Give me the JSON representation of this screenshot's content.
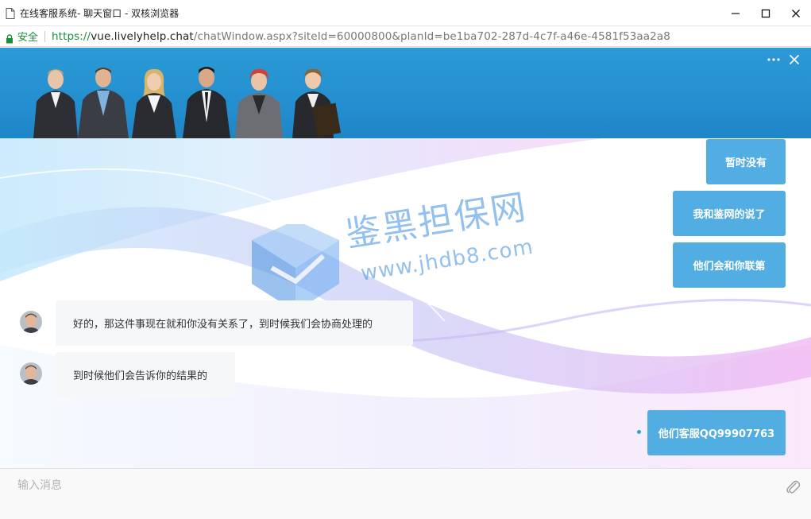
{
  "window": {
    "title": "在线客服系统- 聊天窗口 - 双核浏览器",
    "icons": [
      "document-icon",
      "minimize-icon",
      "maximize-icon",
      "close-icon"
    ]
  },
  "addressbar": {
    "secure_label": "安全",
    "url_scheme": "https://",
    "url_host": "vue.livelyhelp.chat",
    "url_path": "/chatWindow.aspx?siteId=60000800&planId=be1ba702-287d-4c7f-a46e-4581f53aa2a8"
  },
  "chat_header": {
    "icons": [
      "more-icon",
      "close-icon"
    ]
  },
  "watermark": {
    "cn": "鉴黑担保网",
    "en": "www.jhdb8.com"
  },
  "messages": [
    {
      "direction": "out",
      "text": "暂时没有"
    },
    {
      "direction": "out",
      "text": "我和鉴网的说了"
    },
    {
      "direction": "out",
      "text": "他们会和你联第"
    },
    {
      "direction": "in",
      "text": "好的，那这件事现在就和你没有关系了，到时候我们会协商处理的"
    },
    {
      "direction": "in",
      "text": "到时候他们会告诉你的结果的"
    },
    {
      "direction": "out",
      "text": "他们客服QQ99907763"
    }
  ],
  "input": {
    "placeholder": "输入消息",
    "value": ""
  },
  "colors": {
    "banner": "#248fd0",
    "outgoing_bubble": "#52ade3",
    "secure_green": "#1a8f3a"
  }
}
